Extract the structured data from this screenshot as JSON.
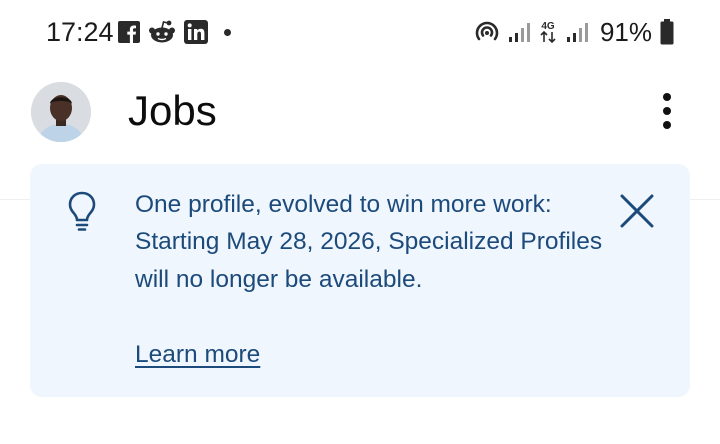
{
  "status_bar": {
    "time": "17:24",
    "notification_icons": [
      "facebook-icon",
      "reddit-icon",
      "linkedin-icon",
      "more-notifications-dot"
    ],
    "system_icons": [
      "hotspot-icon",
      "signal-icon",
      "4g-data-icon",
      "signal-icon-2",
      "battery-icon"
    ],
    "network_label": "4G",
    "battery_percent": "91%",
    "battery_level": 0.91
  },
  "header": {
    "title": "Jobs",
    "menu_icon": "overflow-menu-icon",
    "avatar_icon": "profile-avatar"
  },
  "banner": {
    "icon": "lightbulb-icon",
    "message": "One profile, evolved to win more work: Starting May 28, 2026, Specialized Profiles will no longer be available.",
    "link_label": "Learn more",
    "close_icon": "close-icon"
  },
  "colors": {
    "banner_background": "#f0f6fd",
    "banner_text": "#1c4a7b",
    "title_text": "#0d0d0d",
    "status_text": "#1b1b1b"
  }
}
